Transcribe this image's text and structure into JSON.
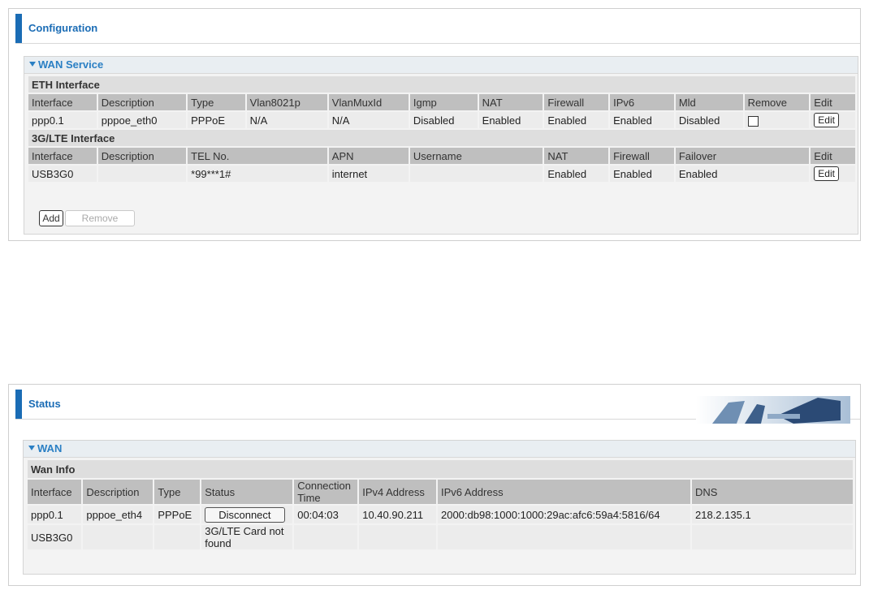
{
  "config": {
    "title": "Configuration",
    "section_title": "WAN Service",
    "eth": {
      "label": "ETH Interface",
      "headers": [
        "Interface",
        "Description",
        "Type",
        "Vlan8021p",
        "VlanMuxId",
        "Igmp",
        "NAT",
        "Firewall",
        "IPv6",
        "Mld",
        "Remove",
        "Edit"
      ],
      "row": [
        "ppp0.1",
        "pppoe_eth0",
        "PPPoE",
        "N/A",
        "N/A",
        "Disabled",
        "Enabled",
        "Enabled",
        "Enabled",
        "Disabled"
      ],
      "edit_label": "Edit"
    },
    "lte": {
      "label": "3G/LTE Interface",
      "headers": [
        "Interface",
        "Description",
        "TEL No.",
        "APN",
        "Username",
        "NAT",
        "Firewall",
        "Failover",
        "Edit"
      ],
      "row": [
        "USB3G0",
        "",
        "*99***1#",
        "internet",
        "",
        "Enabled",
        "Enabled",
        "Enabled"
      ],
      "edit_label": "Edit"
    },
    "add_label": "Add",
    "remove_label": "Remove"
  },
  "status": {
    "title": "Status",
    "section_title": "WAN",
    "sub_label": "Wan Info",
    "headers": [
      "Interface",
      "Description",
      "Type",
      "Status",
      "Connection Time",
      "IPv4 Address",
      "IPv6 Address",
      "DNS"
    ],
    "rows": [
      {
        "interface": "ppp0.1",
        "description": "pppoe_eth4",
        "type": "PPPoE",
        "status_button": "Disconnect",
        "time": "00:04:03",
        "ipv4": "10.40.90.211",
        "ipv6": "2000:db98:1000:1000:29ac:afc6:59a4:5816/64",
        "dns": "218.2.135.1"
      },
      {
        "interface": "USB3G0",
        "description": "",
        "type": "",
        "status": "3G/LTE Card not found",
        "time": "",
        "ipv4": "",
        "ipv6": "",
        "dns": ""
      }
    ]
  },
  "colors": {
    "accent": "#1a6cb5",
    "header_gray": "#bfbfbf",
    "section_bg": "#f3f3f3"
  }
}
